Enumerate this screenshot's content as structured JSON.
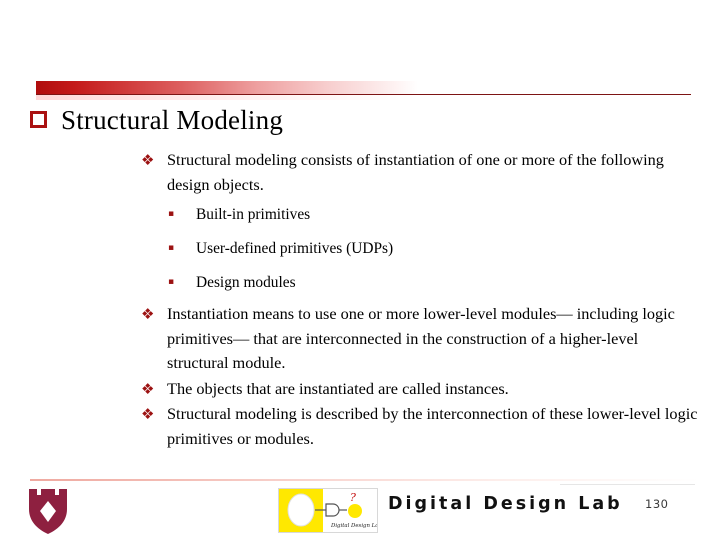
{
  "slide": {
    "title": "Structural Modeling",
    "title_bullet_icon": "hollow-square-bullet",
    "accent_color": "#aa1111",
    "bullet_color": "#9c1212",
    "background_color": "#ffffff"
  },
  "content": {
    "bullets": [
      {
        "level": 1,
        "marker": "❖",
        "text": "Structural modeling consists of instantiation of one or more of the following design objects."
      },
      {
        "level": 2,
        "marker": "▪",
        "text": "Built-in primitives"
      },
      {
        "level": 2,
        "marker": "▪",
        "text": "User-defined primitives (UDPs)"
      },
      {
        "level": 2,
        "marker": "▪",
        "text": "Design modules"
      },
      {
        "level": 1,
        "marker": "❖",
        "text": "Instantiation means to use one or more lower-level modules— including logic primitives— that are interconnected in the construction of a higher-level structural module."
      },
      {
        "level": 1,
        "marker": "❖",
        "text": "The objects that are instantiated are called instances."
      },
      {
        "level": 1,
        "marker": "❖",
        "text": "Structural modeling is described by the interconnection of these lower-level logic primitives or modules."
      }
    ]
  },
  "footer": {
    "lab_name": "Digital Design Lab",
    "page_number": "130",
    "crest_icon": "university-shield-crest",
    "crest_color": "#8e2040",
    "logo_icon": "digital-design-lab-logo",
    "logo_caption": "Digital Design Lab",
    "logo_bg_color": "#ffe800",
    "logo_marker": "?"
  }
}
